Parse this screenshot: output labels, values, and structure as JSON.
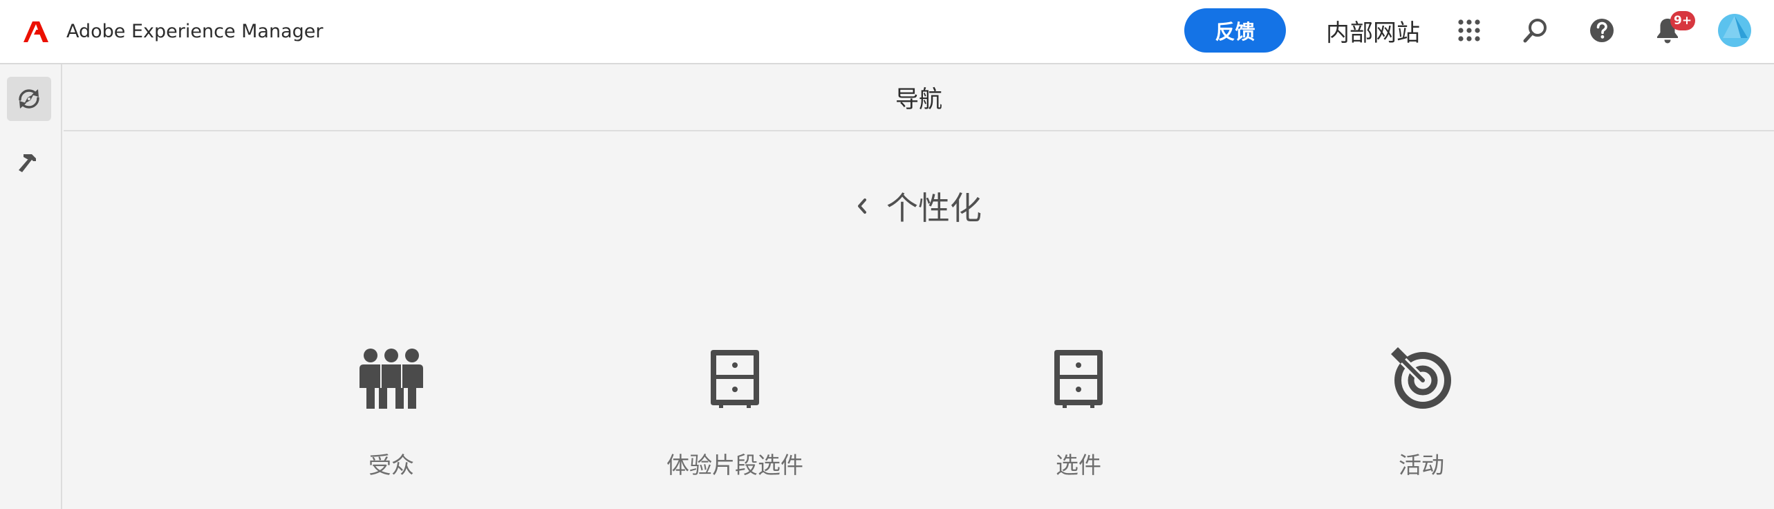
{
  "header": {
    "app_name": "Adobe Experience Manager",
    "feedback_label": "反馈",
    "site_label": "内部网站",
    "notification_count": "9+",
    "icons": [
      "adobe-logo",
      "apps-grid-icon",
      "search-icon",
      "help-icon",
      "bell-icon",
      "user-avatar"
    ],
    "accent_color": "#1473e6",
    "badge_color": "#d7373f",
    "logo_color": "#eb1000"
  },
  "rail": {
    "items": [
      {
        "icon": "navigation-compass-icon",
        "selected": true
      },
      {
        "icon": "tools-hammer-icon",
        "selected": false
      }
    ]
  },
  "main": {
    "panel_title": "导航",
    "section_title": "个性化",
    "back_icon": "chevron-left-icon",
    "tiles": [
      {
        "label": "受众",
        "icon": "audience-people-icon"
      },
      {
        "label": "体验片段选件",
        "icon": "drawer-cabinet-icon"
      },
      {
        "label": "选件",
        "icon": "drawer-cabinet-icon"
      },
      {
        "label": "活动",
        "icon": "target-activity-icon"
      }
    ]
  }
}
